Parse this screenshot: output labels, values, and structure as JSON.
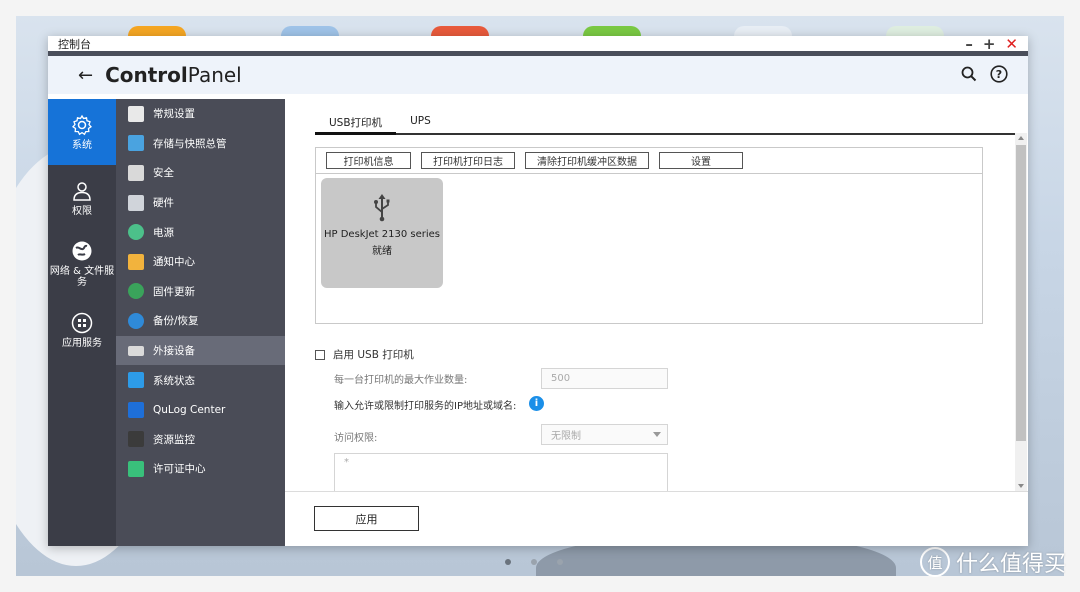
{
  "window": {
    "title": "控制台"
  },
  "header": {
    "back_icon": "arrow-left-icon",
    "title_bold": "Control",
    "title_rest": "Panel"
  },
  "rail": [
    {
      "label": "系统",
      "icon": "gear-icon",
      "active": true
    },
    {
      "label": "权限",
      "icon": "user-icon",
      "active": false
    },
    {
      "label": "网络 & 文件服务",
      "icon": "globe-icon",
      "active": false
    },
    {
      "label": "应用服务",
      "icon": "apps-icon",
      "active": false
    }
  ],
  "submenu": [
    {
      "label": "常规设置",
      "color": "#e9e9e9"
    },
    {
      "label": "存储与快照总管",
      "color": "#4aa3e0"
    },
    {
      "label": "安全",
      "color": "#d9d9d9"
    },
    {
      "label": "硬件",
      "color": "#d0d4da"
    },
    {
      "label": "电源",
      "color": "#4cc08a"
    },
    {
      "label": "通知中心",
      "color": "#f2b33d"
    },
    {
      "label": "固件更新",
      "color": "#3aa35b"
    },
    {
      "label": "备份/恢复",
      "color": "#2f8ad8"
    },
    {
      "label": "外接设备",
      "color": "#dadada",
      "active": true
    },
    {
      "label": "系统状态",
      "color": "#2d9be8"
    },
    {
      "label": "QuLog Center",
      "color": "#1e6fd9"
    },
    {
      "label": "资源监控",
      "color": "#3b3b3b"
    },
    {
      "label": "许可证中心",
      "color": "#39c07b"
    }
  ],
  "tabs": [
    {
      "label": "USB打印机",
      "active": true
    },
    {
      "label": "UPS",
      "active": false
    }
  ],
  "printer_buttons": [
    "打印机信息",
    "打印机打印日志",
    "清除打印机缓冲区数据",
    "设置"
  ],
  "printer": {
    "name": "HP DeskJet 2130 series",
    "status": "就绪",
    "icon": "usb-icon"
  },
  "form": {
    "enable_label": "启用 USB 打印机",
    "max_jobs_label": "每一台打印机的最大作业数量:",
    "max_jobs_value": "500",
    "ip_label": "输入允许或限制打印服务的IP地址或域名:",
    "access_label": "访问权限:",
    "access_value": "无限制",
    "textarea_value": "*"
  },
  "footer": {
    "apply_label": "应用"
  },
  "watermark": {
    "text": "什么值得买",
    "logo": "值"
  }
}
